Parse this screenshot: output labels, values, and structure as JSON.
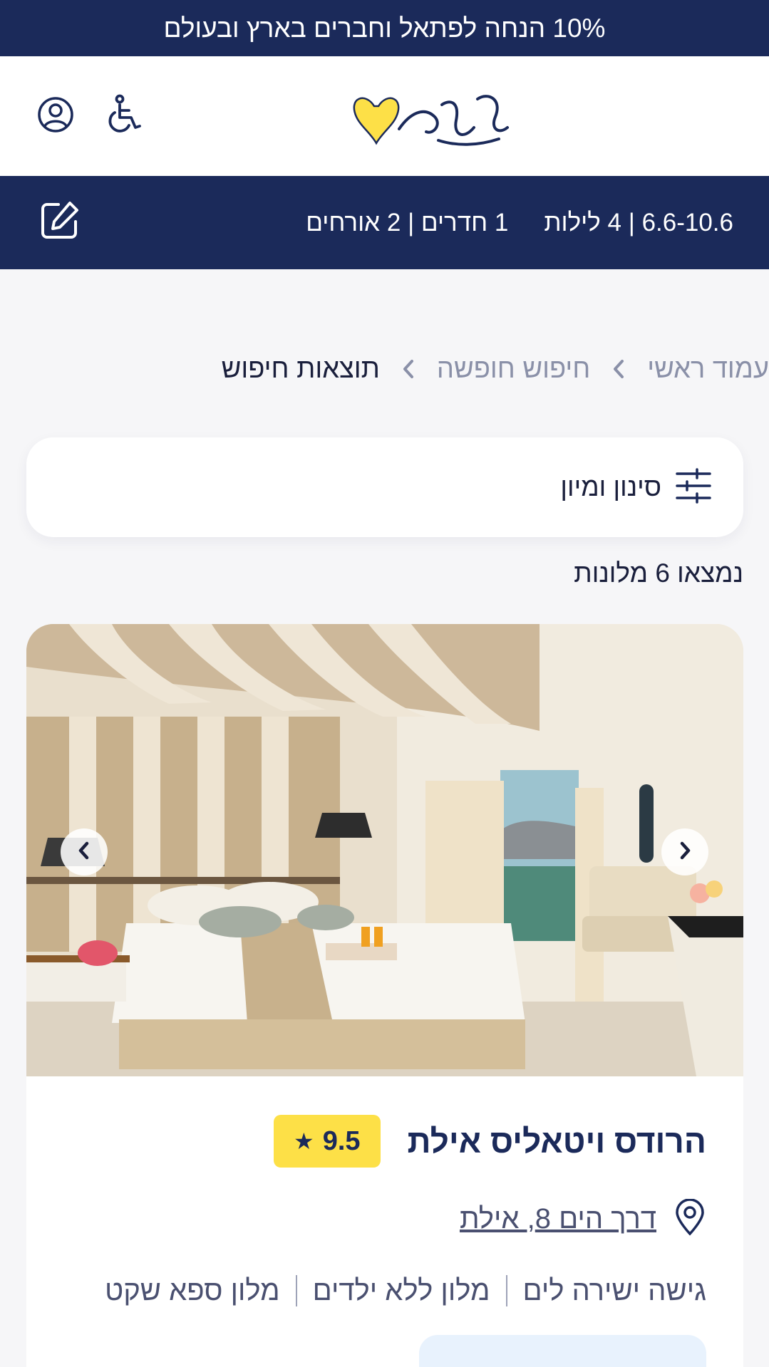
{
  "promo": {
    "text": "10% הנחה לפתאל וחברים בארץ ובעולם"
  },
  "header": {
    "logo_alt": "fattal פתאל",
    "accessibility_icon": "wheelchair-icon",
    "account_icon": "user-circle-icon"
  },
  "search": {
    "dates": "6.6-10.6",
    "nights": "4 לילות",
    "rooms": "1 חדרים",
    "guests": "2 אורחים",
    "edit_icon": "edit-icon"
  },
  "breadcrumb": {
    "items": [
      "עמוד ראשי",
      "חיפוש חופשה",
      "תוצאות חיפוש"
    ]
  },
  "filter": {
    "label": "סינון ומיון",
    "icon": "sliders-icon"
  },
  "results": {
    "count_text": "נמצאו 6 מלונות"
  },
  "hotel": {
    "name": "הרודס ויטאליס אילת",
    "rating": "9.5",
    "address": "דרך הים 8, אילת",
    "tags": [
      "גישה ישירה לים",
      "מלון ללא ילדים",
      "מלון ספא שקט"
    ]
  },
  "colors": {
    "navy": "#1b2a5a",
    "yellow": "#fde047",
    "background": "#f6f6f8",
    "deal_box": "#e8f2fd"
  }
}
